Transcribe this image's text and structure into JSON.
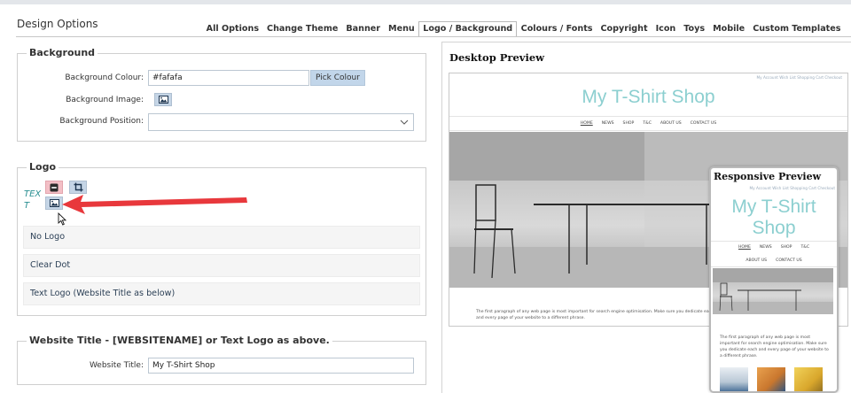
{
  "page": {
    "title": "Design Options"
  },
  "tabs": [
    {
      "label": "All Options"
    },
    {
      "label": "Change Theme"
    },
    {
      "label": "Banner"
    },
    {
      "label": "Menu"
    },
    {
      "label": "Logo / Background",
      "active": true
    },
    {
      "label": "Colours / Fonts"
    },
    {
      "label": "Copyright"
    },
    {
      "label": "Icon"
    },
    {
      "label": "Toys"
    },
    {
      "label": "Mobile"
    },
    {
      "label": "Custom Templates"
    }
  ],
  "background": {
    "legend": "Background",
    "colour_label": "Background Colour:",
    "colour_value": "#fafafa",
    "pick_label": "Pick Colour",
    "image_label": "Background Image:",
    "position_label": "Background Position:",
    "position_value": ""
  },
  "logo": {
    "legend": "Logo",
    "text_tag": "TEXT",
    "options": [
      "No Logo",
      "Clear Dot",
      "Text Logo (Website Title as below)"
    ]
  },
  "website_title": {
    "legend": "Website Title - [WEBSITENAME] or Text Logo as above.",
    "label": "Website Title:",
    "value": "My T-Shirt Shop"
  },
  "preview": {
    "desktop_title": "Desktop Preview",
    "responsive_title": "Responsive Preview",
    "shop_name": "My T-Shirt Shop",
    "top_links": "My Account  Wish List  Shopping Cart  Checkout",
    "nav": [
      "HOME",
      "NEWS",
      "SHOP",
      "T&C",
      "ABOUT US",
      "CONTACT US"
    ],
    "nav_row1": [
      "HOME",
      "NEWS",
      "SHOP",
      "T&C"
    ],
    "nav_row2": [
      "ABOUT US",
      "CONTACT US"
    ],
    "paragraph": "The first paragraph of any web page is most important for search engine optimisation. Make sure you dedicate each and every page of your website to a different phrase."
  },
  "colors": {
    "shop_title": "#8ccfd0",
    "text_tag": "#2a8f92",
    "arrow": "#e8383c",
    "button_blue": "#c5d5e6",
    "button_red": "#f3bfc6"
  }
}
